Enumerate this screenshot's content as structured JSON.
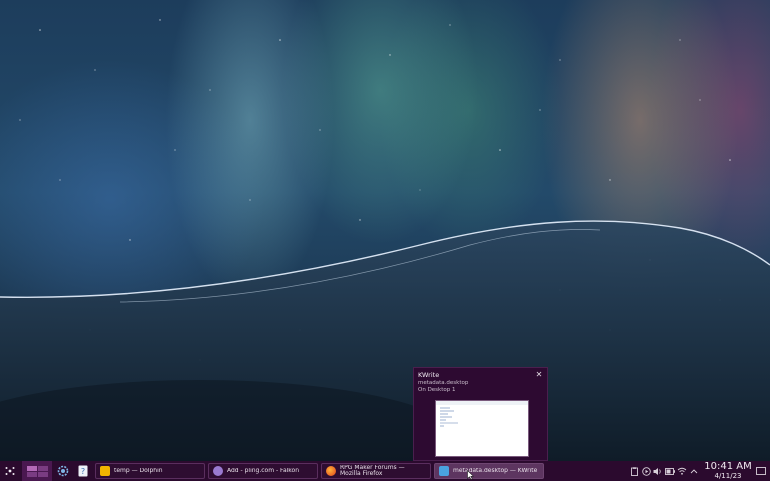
{
  "desktop": {
    "wallpaper": "aurora-night-wave"
  },
  "taskbar": {
    "kickoff": {
      "icon": "kde-app-launcher-icon"
    },
    "pager": {
      "icon": "virtual-desktop-pager-icon",
      "desktops": 4,
      "active": 1
    },
    "launchers": [
      {
        "icon": "system-settings-icon"
      },
      {
        "icon": "help-center-icon"
      }
    ],
    "tasks": [
      {
        "label": "temp — Dolphin",
        "icon": "dolphin-folder-icon",
        "color": "#f0b400"
      },
      {
        "label": "Add - pling.com - Falkon",
        "icon": "falkon-browser-icon",
        "color": "#9a7ad0"
      },
      {
        "label": "RPG Maker Forums — Mozilla Firefox",
        "icon": "firefox-icon",
        "color": "#ff7a1a"
      },
      {
        "label": "metadata.desktop — KWrite",
        "icon": "kwrite-icon",
        "color": "#4aa3df",
        "active": true
      }
    ],
    "tray": [
      {
        "icon": "clipboard-icon"
      },
      {
        "icon": "media-player-icon"
      },
      {
        "icon": "volume-icon"
      },
      {
        "icon": "battery-icon"
      },
      {
        "icon": "wifi-icon"
      },
      {
        "icon": "expand-tray-arrow-icon"
      }
    ],
    "clock": {
      "time": "10:41 AM",
      "date": "4/11/23"
    },
    "show_desktop": {
      "icon": "show-desktop-icon"
    }
  },
  "tooltip": {
    "title": "KWrite",
    "subtitle": "metadata.desktop",
    "desktop": "On Desktop 1",
    "close_glyph": "✕"
  }
}
